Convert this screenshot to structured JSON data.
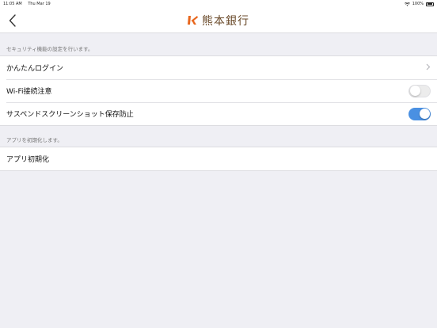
{
  "status_bar": {
    "time": "11:05 AM",
    "date": "Thu Mar 19",
    "battery": "100%",
    "wifi_icon": "wifi-icon",
    "battery_icon": "battery-icon"
  },
  "nav": {
    "brand_name": "熊本銀行",
    "back_icon": "chevron-left-icon",
    "brand_color": "#6a4a2a",
    "logo_color": "#e8661c"
  },
  "sections": [
    {
      "header": "セキュリティ機能の設定を行います。",
      "rows": [
        {
          "label": "かんたんログイン",
          "accessory": "chevron"
        },
        {
          "label": "Wi-Fi接続注意",
          "accessory": "toggle",
          "on": false
        },
        {
          "label": "サスペンドスクリーンショット保存防止",
          "accessory": "toggle",
          "on": true
        }
      ]
    },
    {
      "header": "アプリを初期化します。",
      "rows": [
        {
          "label": "アプリ初期化",
          "accessory": "none"
        }
      ]
    }
  ],
  "colors": {
    "accent": "#4a90e2",
    "background": "#efeff4"
  }
}
